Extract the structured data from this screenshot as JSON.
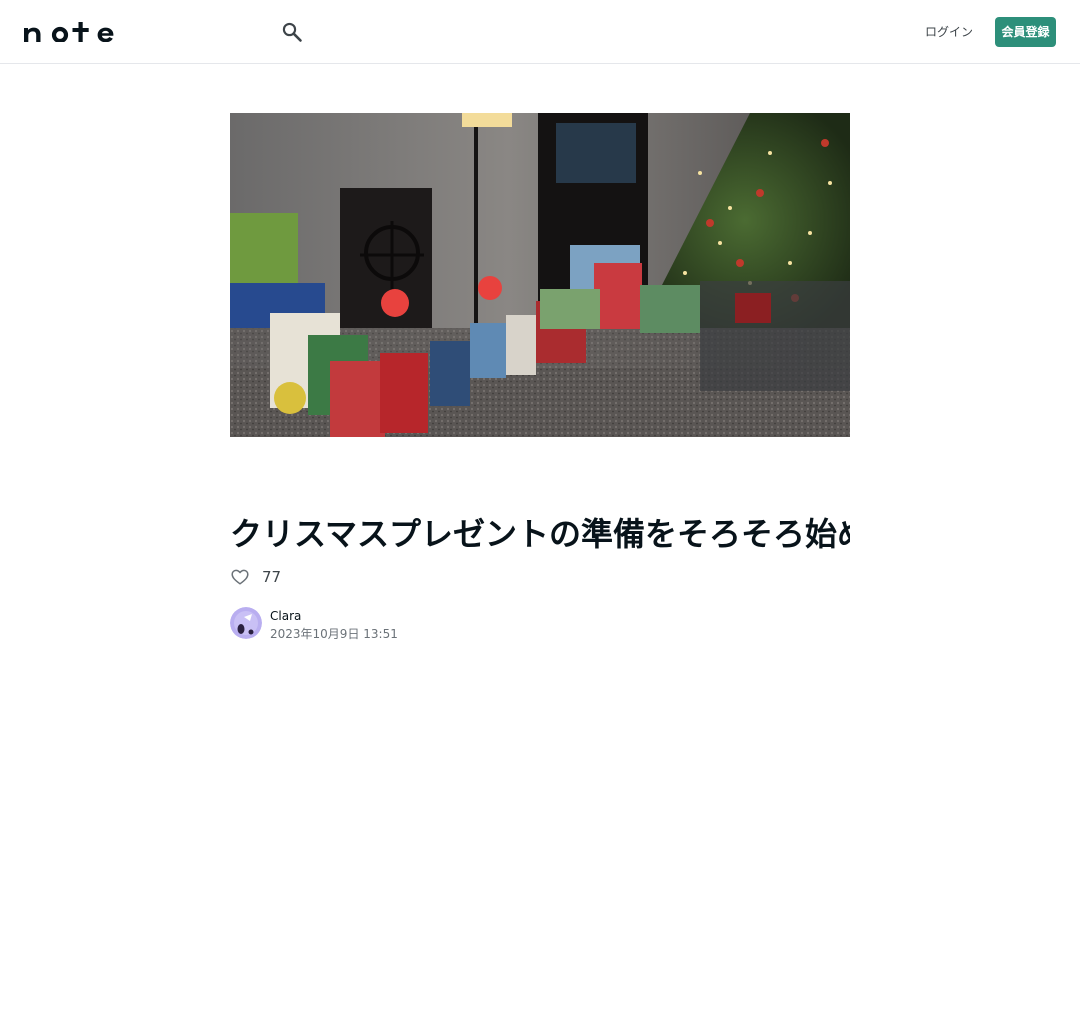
{
  "header": {
    "logo_text": "note",
    "search_icon": "search-icon",
    "login_label": "ログイン",
    "signup_label": "会員登録",
    "accent_color": "#2d8f7a"
  },
  "article": {
    "hero_image": "christmas-tree-and-wrapped-gifts-photo",
    "title": "クリスマスプレゼントの準備をそろそろ始めていますか？",
    "like_icon": "heart-outline-icon",
    "like_count": "77",
    "author": {
      "name": "Clara",
      "avatar": "avatar"
    },
    "date": "2023年10月9日 13:51"
  }
}
